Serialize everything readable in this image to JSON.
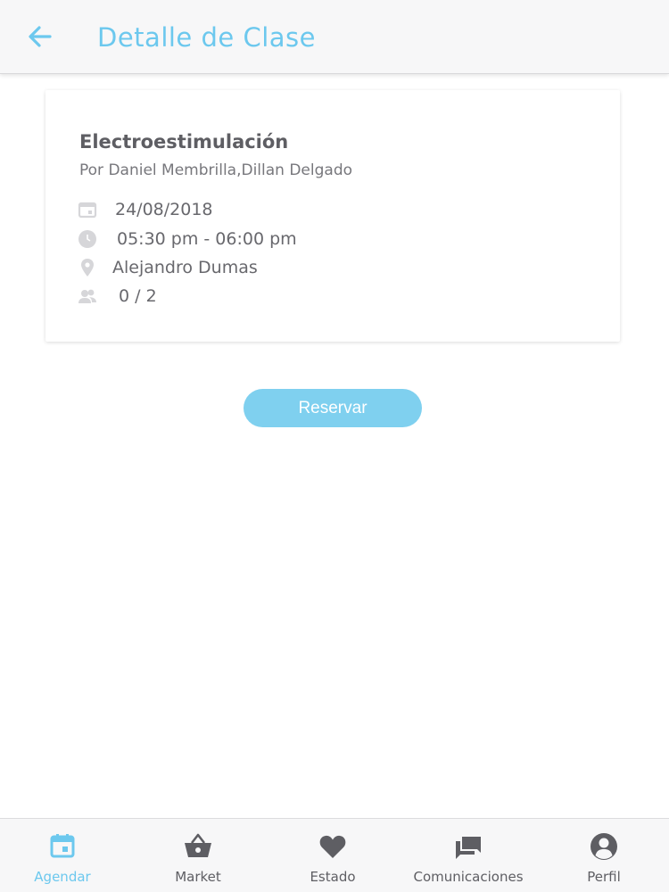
{
  "header": {
    "title": "Detalle de Clase",
    "back_icon": "arrow-left-icon"
  },
  "card": {
    "class_name": "Electroestimulación",
    "instructors": "Por Daniel Membrilla,Dillan Delgado",
    "date": "24/08/2018",
    "time": "05:30 pm - 06:00 pm",
    "location": "Alejandro Dumas",
    "capacity": "0 / 2",
    "icons": [
      "calendar-icon",
      "clock-icon",
      "location-pin-icon",
      "people-icon"
    ]
  },
  "actions": {
    "reserve_label": "Reservar"
  },
  "tabbar": {
    "active": "Agendar",
    "tabs": [
      {
        "label": "Agendar",
        "icon": "calendar-icon"
      },
      {
        "label": "Market",
        "icon": "basket-icon"
      },
      {
        "label": "Estado",
        "icon": "heart-icon"
      },
      {
        "label": "Comunicaciones",
        "icon": "chat-icon"
      },
      {
        "label": "Perfil",
        "icon": "account-icon"
      }
    ]
  },
  "colors": {
    "accent": "#6cc8ee",
    "button": "#7fd0ef",
    "text_dark": "#5e5e63",
    "icon_muted": "#d6d6d9"
  }
}
